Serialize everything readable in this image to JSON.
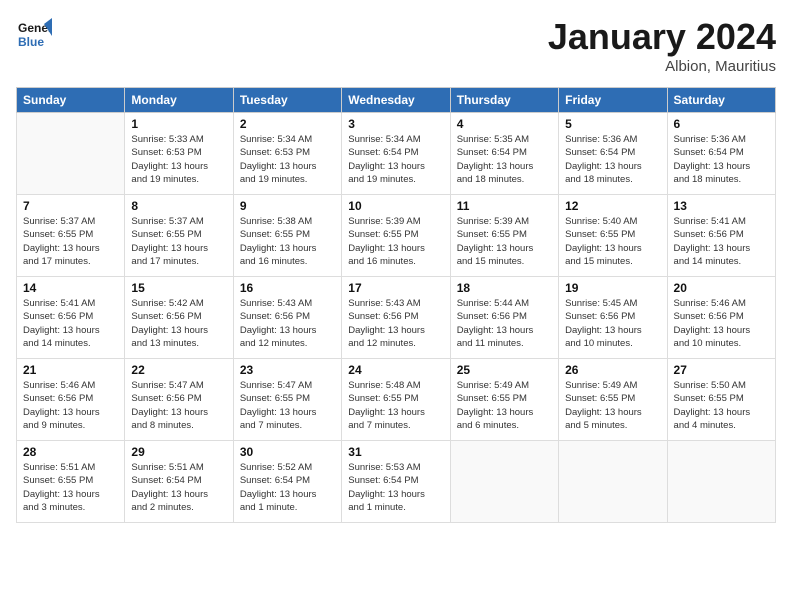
{
  "header": {
    "logo_line1": "General",
    "logo_line2": "Blue",
    "month": "January 2024",
    "location": "Albion, Mauritius"
  },
  "days_of_week": [
    "Sunday",
    "Monday",
    "Tuesday",
    "Wednesday",
    "Thursday",
    "Friday",
    "Saturday"
  ],
  "weeks": [
    [
      {
        "day": "",
        "info": ""
      },
      {
        "day": "1",
        "info": "Sunrise: 5:33 AM\nSunset: 6:53 PM\nDaylight: 13 hours\nand 19 minutes."
      },
      {
        "day": "2",
        "info": "Sunrise: 5:34 AM\nSunset: 6:53 PM\nDaylight: 13 hours\nand 19 minutes."
      },
      {
        "day": "3",
        "info": "Sunrise: 5:34 AM\nSunset: 6:54 PM\nDaylight: 13 hours\nand 19 minutes."
      },
      {
        "day": "4",
        "info": "Sunrise: 5:35 AM\nSunset: 6:54 PM\nDaylight: 13 hours\nand 18 minutes."
      },
      {
        "day": "5",
        "info": "Sunrise: 5:36 AM\nSunset: 6:54 PM\nDaylight: 13 hours\nand 18 minutes."
      },
      {
        "day": "6",
        "info": "Sunrise: 5:36 AM\nSunset: 6:54 PM\nDaylight: 13 hours\nand 18 minutes."
      }
    ],
    [
      {
        "day": "7",
        "info": "Sunrise: 5:37 AM\nSunset: 6:55 PM\nDaylight: 13 hours\nand 17 minutes."
      },
      {
        "day": "8",
        "info": "Sunrise: 5:37 AM\nSunset: 6:55 PM\nDaylight: 13 hours\nand 17 minutes."
      },
      {
        "day": "9",
        "info": "Sunrise: 5:38 AM\nSunset: 6:55 PM\nDaylight: 13 hours\nand 16 minutes."
      },
      {
        "day": "10",
        "info": "Sunrise: 5:39 AM\nSunset: 6:55 PM\nDaylight: 13 hours\nand 16 minutes."
      },
      {
        "day": "11",
        "info": "Sunrise: 5:39 AM\nSunset: 6:55 PM\nDaylight: 13 hours\nand 15 minutes."
      },
      {
        "day": "12",
        "info": "Sunrise: 5:40 AM\nSunset: 6:55 PM\nDaylight: 13 hours\nand 15 minutes."
      },
      {
        "day": "13",
        "info": "Sunrise: 5:41 AM\nSunset: 6:56 PM\nDaylight: 13 hours\nand 14 minutes."
      }
    ],
    [
      {
        "day": "14",
        "info": "Sunrise: 5:41 AM\nSunset: 6:56 PM\nDaylight: 13 hours\nand 14 minutes."
      },
      {
        "day": "15",
        "info": "Sunrise: 5:42 AM\nSunset: 6:56 PM\nDaylight: 13 hours\nand 13 minutes."
      },
      {
        "day": "16",
        "info": "Sunrise: 5:43 AM\nSunset: 6:56 PM\nDaylight: 13 hours\nand 12 minutes."
      },
      {
        "day": "17",
        "info": "Sunrise: 5:43 AM\nSunset: 6:56 PM\nDaylight: 13 hours\nand 12 minutes."
      },
      {
        "day": "18",
        "info": "Sunrise: 5:44 AM\nSunset: 6:56 PM\nDaylight: 13 hours\nand 11 minutes."
      },
      {
        "day": "19",
        "info": "Sunrise: 5:45 AM\nSunset: 6:56 PM\nDaylight: 13 hours\nand 10 minutes."
      },
      {
        "day": "20",
        "info": "Sunrise: 5:46 AM\nSunset: 6:56 PM\nDaylight: 13 hours\nand 10 minutes."
      }
    ],
    [
      {
        "day": "21",
        "info": "Sunrise: 5:46 AM\nSunset: 6:56 PM\nDaylight: 13 hours\nand 9 minutes."
      },
      {
        "day": "22",
        "info": "Sunrise: 5:47 AM\nSunset: 6:56 PM\nDaylight: 13 hours\nand 8 minutes."
      },
      {
        "day": "23",
        "info": "Sunrise: 5:47 AM\nSunset: 6:55 PM\nDaylight: 13 hours\nand 7 minutes."
      },
      {
        "day": "24",
        "info": "Sunrise: 5:48 AM\nSunset: 6:55 PM\nDaylight: 13 hours\nand 7 minutes."
      },
      {
        "day": "25",
        "info": "Sunrise: 5:49 AM\nSunset: 6:55 PM\nDaylight: 13 hours\nand 6 minutes."
      },
      {
        "day": "26",
        "info": "Sunrise: 5:49 AM\nSunset: 6:55 PM\nDaylight: 13 hours\nand 5 minutes."
      },
      {
        "day": "27",
        "info": "Sunrise: 5:50 AM\nSunset: 6:55 PM\nDaylight: 13 hours\nand 4 minutes."
      }
    ],
    [
      {
        "day": "28",
        "info": "Sunrise: 5:51 AM\nSunset: 6:55 PM\nDaylight: 13 hours\nand 3 minutes."
      },
      {
        "day": "29",
        "info": "Sunrise: 5:51 AM\nSunset: 6:54 PM\nDaylight: 13 hours\nand 2 minutes."
      },
      {
        "day": "30",
        "info": "Sunrise: 5:52 AM\nSunset: 6:54 PM\nDaylight: 13 hours\nand 1 minute."
      },
      {
        "day": "31",
        "info": "Sunrise: 5:53 AM\nSunset: 6:54 PM\nDaylight: 13 hours\nand 1 minute."
      },
      {
        "day": "",
        "info": ""
      },
      {
        "day": "",
        "info": ""
      },
      {
        "day": "",
        "info": ""
      }
    ]
  ]
}
